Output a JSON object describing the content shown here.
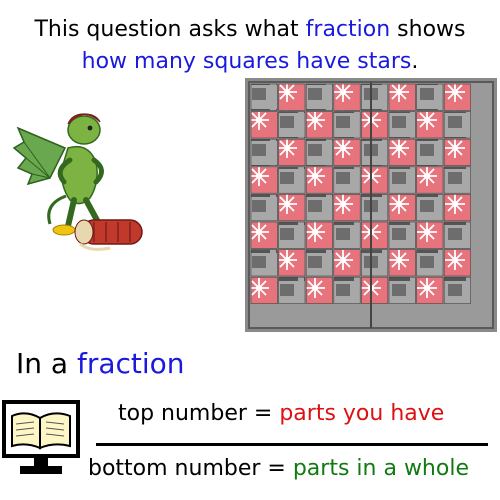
{
  "intro": {
    "part1": "This question asks what ",
    "highlight1": "fraction",
    "part2": " shows",
    "highlight2": "how many squares have stars",
    "part3": "."
  },
  "subheading": {
    "prefix": "In a ",
    "highlight": "fraction"
  },
  "fraction_rule": {
    "top_prefix": "top number = ",
    "top_value": "parts you have",
    "bottom_prefix": "bottom number = ",
    "bottom_value": "parts in a whole"
  },
  "colors": {
    "highlight_blue": "#1a1adf",
    "top_red": "#dd1111",
    "bottom_green": "#117a11",
    "board_red": "#e7747d",
    "board_gray": "#9a9a9a"
  }
}
